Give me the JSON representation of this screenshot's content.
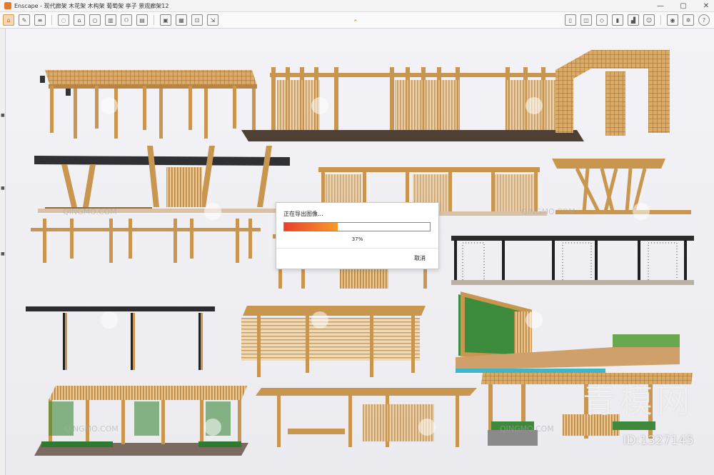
{
  "window": {
    "title": "Enscape - 现代廊架 木花架 木构架 葡萄架 亭子 景观廊架12",
    "controls": [
      "—",
      "▢",
      "✕"
    ]
  },
  "toolbar": {
    "left_icons": [
      "home-icon",
      "tag-icon",
      "bim-icon",
      "assets-icon",
      "house-icon",
      "bulb-icon",
      "building-icon",
      "group-icon",
      "film-icon",
      "image-export-icon",
      "batch-export-icon",
      "panorama-icon",
      "export-icon"
    ],
    "right_icons": [
      "book-icon",
      "screenshot-icon",
      "cube-icon",
      "chart-icon",
      "building-settings-icon",
      "user-icon",
      "eye-icon",
      "settings-icon",
      "help-icon"
    ]
  },
  "dialog": {
    "title": "正在导出图像...",
    "progress": 37,
    "percent_label": "37%",
    "cancel_label": "取消"
  },
  "watermark": {
    "logo_text": "青模网",
    "id_text": "ID:1327145",
    "small_text": "QINGMO.COM"
  },
  "colors": {
    "wood": "#c8964e",
    "wood_dark": "#a8763a",
    "progress_start": "#e8412b",
    "progress_end": "#f99a2a",
    "accent": "#e07a1b"
  }
}
